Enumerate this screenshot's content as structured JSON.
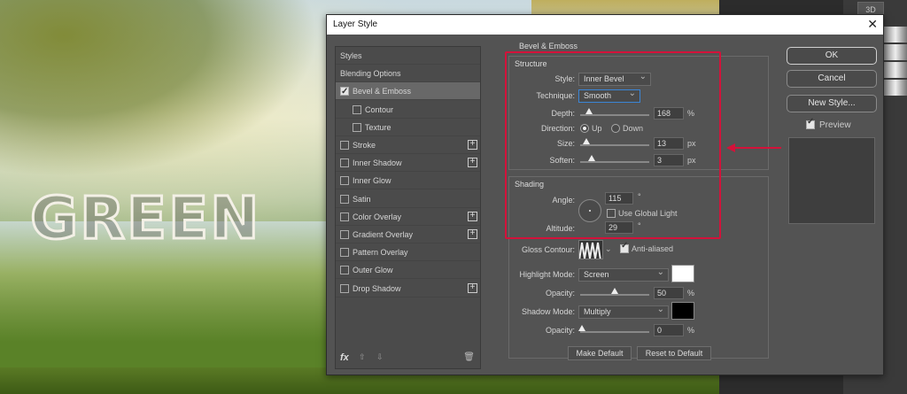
{
  "background": {
    "overlay_text": "GREEN"
  },
  "app": {
    "button_3d": "3D"
  },
  "dialog": {
    "title": "Layer Style",
    "close_glyph": "✕",
    "left_list": [
      {
        "label": "Styles",
        "checkbox": false,
        "checked": false,
        "plus": false,
        "selected": false,
        "indent": 0
      },
      {
        "label": "Blending Options",
        "checkbox": false,
        "checked": false,
        "plus": false,
        "selected": false,
        "indent": 0
      },
      {
        "label": "Bevel & Emboss",
        "checkbox": true,
        "checked": true,
        "plus": false,
        "selected": true,
        "indent": 0
      },
      {
        "label": "Contour",
        "checkbox": true,
        "checked": false,
        "plus": false,
        "selected": false,
        "indent": 1
      },
      {
        "label": "Texture",
        "checkbox": true,
        "checked": false,
        "plus": false,
        "selected": false,
        "indent": 1
      },
      {
        "label": "Stroke",
        "checkbox": true,
        "checked": false,
        "plus": true,
        "selected": false,
        "indent": 0
      },
      {
        "label": "Inner Shadow",
        "checkbox": true,
        "checked": false,
        "plus": true,
        "selected": false,
        "indent": 0
      },
      {
        "label": "Inner Glow",
        "checkbox": true,
        "checked": false,
        "plus": false,
        "selected": false,
        "indent": 0
      },
      {
        "label": "Satin",
        "checkbox": true,
        "checked": false,
        "plus": false,
        "selected": false,
        "indent": 0
      },
      {
        "label": "Color Overlay",
        "checkbox": true,
        "checked": false,
        "plus": true,
        "selected": false,
        "indent": 0
      },
      {
        "label": "Gradient Overlay",
        "checkbox": true,
        "checked": false,
        "plus": true,
        "selected": false,
        "indent": 0
      },
      {
        "label": "Pattern Overlay",
        "checkbox": true,
        "checked": false,
        "plus": false,
        "selected": false,
        "indent": 0
      },
      {
        "label": "Outer Glow",
        "checkbox": true,
        "checked": false,
        "plus": false,
        "selected": false,
        "indent": 0
      },
      {
        "label": "Drop Shadow",
        "checkbox": true,
        "checked": false,
        "plus": true,
        "selected": false,
        "indent": 0
      }
    ],
    "footer": {
      "fx": "fx",
      "up": "⇧",
      "down": "⇩",
      "trash": "🗑"
    },
    "panel": {
      "section_title": "Bevel & Emboss",
      "structure": {
        "title": "Structure",
        "style_label": "Style:",
        "style_value": "Inner Bevel",
        "technique_label": "Technique:",
        "technique_value": "Smooth",
        "depth_label": "Depth:",
        "depth_value": "168",
        "depth_unit": "%",
        "direction_label": "Direction:",
        "direction_up": "Up",
        "direction_down": "Down",
        "direction_selected": "up",
        "size_label": "Size:",
        "size_value": "13",
        "size_unit": "px",
        "soften_label": "Soften:",
        "soften_value": "3",
        "soften_unit": "px"
      },
      "shading": {
        "title": "Shading",
        "angle_label": "Angle:",
        "angle_value": "115",
        "angle_unit": "°",
        "use_global_light": "Use Global Light",
        "use_global_light_checked": false,
        "altitude_label": "Altitude:",
        "altitude_value": "29",
        "altitude_unit": "°",
        "gloss_contour_label": "Gloss Contour:",
        "anti_aliased": "Anti-aliased",
        "anti_aliased_checked": true,
        "highlight_mode_label": "Highlight Mode:",
        "highlight_mode_value": "Screen",
        "highlight_color": "#ffffff",
        "highlight_opacity_label": "Opacity:",
        "highlight_opacity_value": "50",
        "highlight_opacity_unit": "%",
        "shadow_mode_label": "Shadow Mode:",
        "shadow_mode_value": "Multiply",
        "shadow_color": "#000000",
        "shadow_opacity_label": "Opacity:",
        "shadow_opacity_value": "0",
        "shadow_opacity_unit": "%"
      },
      "make_default": "Make Default",
      "reset_to_default": "Reset to Default"
    },
    "buttons": {
      "ok": "OK",
      "cancel": "Cancel",
      "new_style": "New Style..."
    },
    "preview_label": "Preview",
    "preview_checked": true
  },
  "annotation": {
    "color": "#d3123a"
  }
}
